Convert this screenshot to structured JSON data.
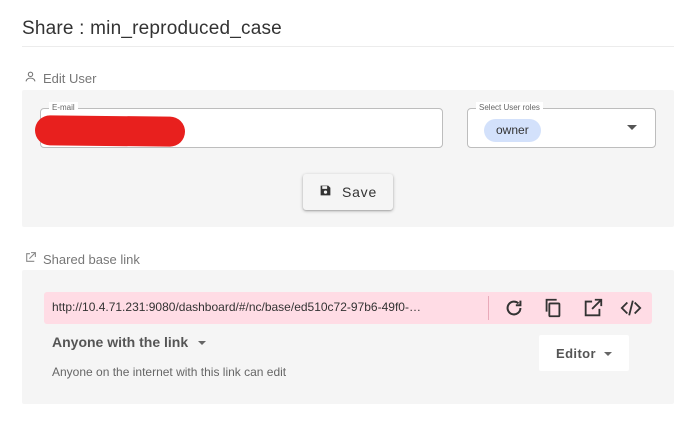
{
  "header": {
    "title": "Share : min_reproduced_case"
  },
  "edit_user": {
    "label": "Edit User",
    "email": {
      "legend": "E-mail",
      "value": ""
    },
    "roles": {
      "legend": "Select User roles",
      "selected": "owner"
    },
    "save_label": "Save"
  },
  "shared_link": {
    "label": "Shared base link",
    "url": "http://10.4.71.231:9080/dashboard/#/nc/base/ed510c72-97b6-49f0-…",
    "actions": [
      "reload-icon",
      "copy-icon",
      "open-in-new-icon",
      "embed-code-icon"
    ],
    "access_label": "Anyone with the link",
    "access_description": "Anyone on the internet with this link can edit",
    "permission": "Editor"
  },
  "colors": {
    "panel_bg": "#f5f5f5",
    "chip_bg": "#d3e1fb",
    "link_bar_bg": "#ffdce5",
    "redaction": "#e8201e"
  }
}
